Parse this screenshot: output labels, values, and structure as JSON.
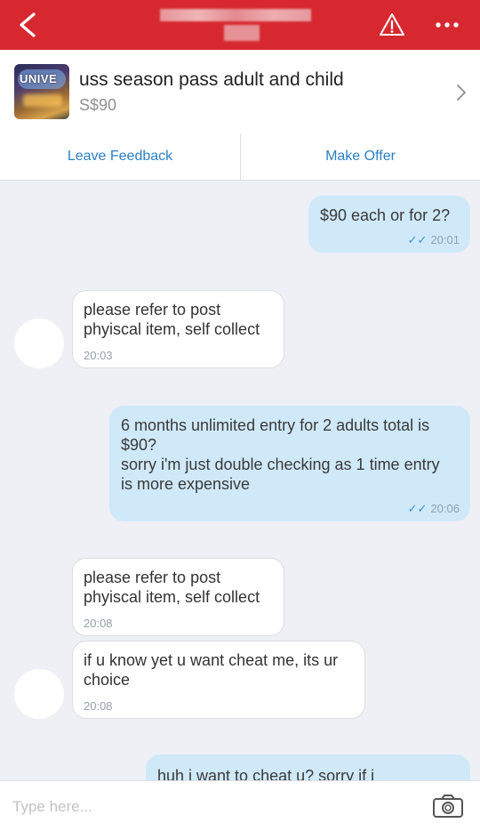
{
  "header": {
    "back_icon": "chevron-left-icon",
    "warning_icon": "warning-icon",
    "more_icon": "more-icon",
    "background": "#d7282f"
  },
  "listing": {
    "title": "uss season pass adult and child",
    "price": "S$90",
    "thumb_text": "UNIVE"
  },
  "actions": {
    "leave_feedback": "Leave Feedback",
    "make_offer": "Make Offer",
    "accent": "#2d7fc2"
  },
  "messages": [
    {
      "side": "out",
      "lines": [
        "$90 each or for 2?"
      ],
      "time": "20:01",
      "read": true
    },
    {
      "side": "in",
      "lines": [
        "please refer to post",
        "phyiscal item, self collect"
      ],
      "time": "20:03"
    },
    {
      "side": "out",
      "lines": [
        "6 months unlimited entry for 2 adults total is",
        "$90?",
        "sorry i'm just double checking as 1 time entry",
        "is more expensive"
      ],
      "time": "20:06",
      "read": true
    },
    {
      "side": "in",
      "lines": [
        "please refer to post",
        "phyiscal item, self collect"
      ],
      "time": "20:08"
    },
    {
      "side": "in",
      "lines": [
        "if u know yet u want cheat me, its ur",
        "choice"
      ],
      "time": "20:08"
    },
    {
      "side": "out",
      "lines": [
        "huh i want to cheat u? sorry if i"
      ],
      "time": ""
    }
  ],
  "composer": {
    "placeholder": "Type here...",
    "camera_icon": "camera-icon"
  }
}
